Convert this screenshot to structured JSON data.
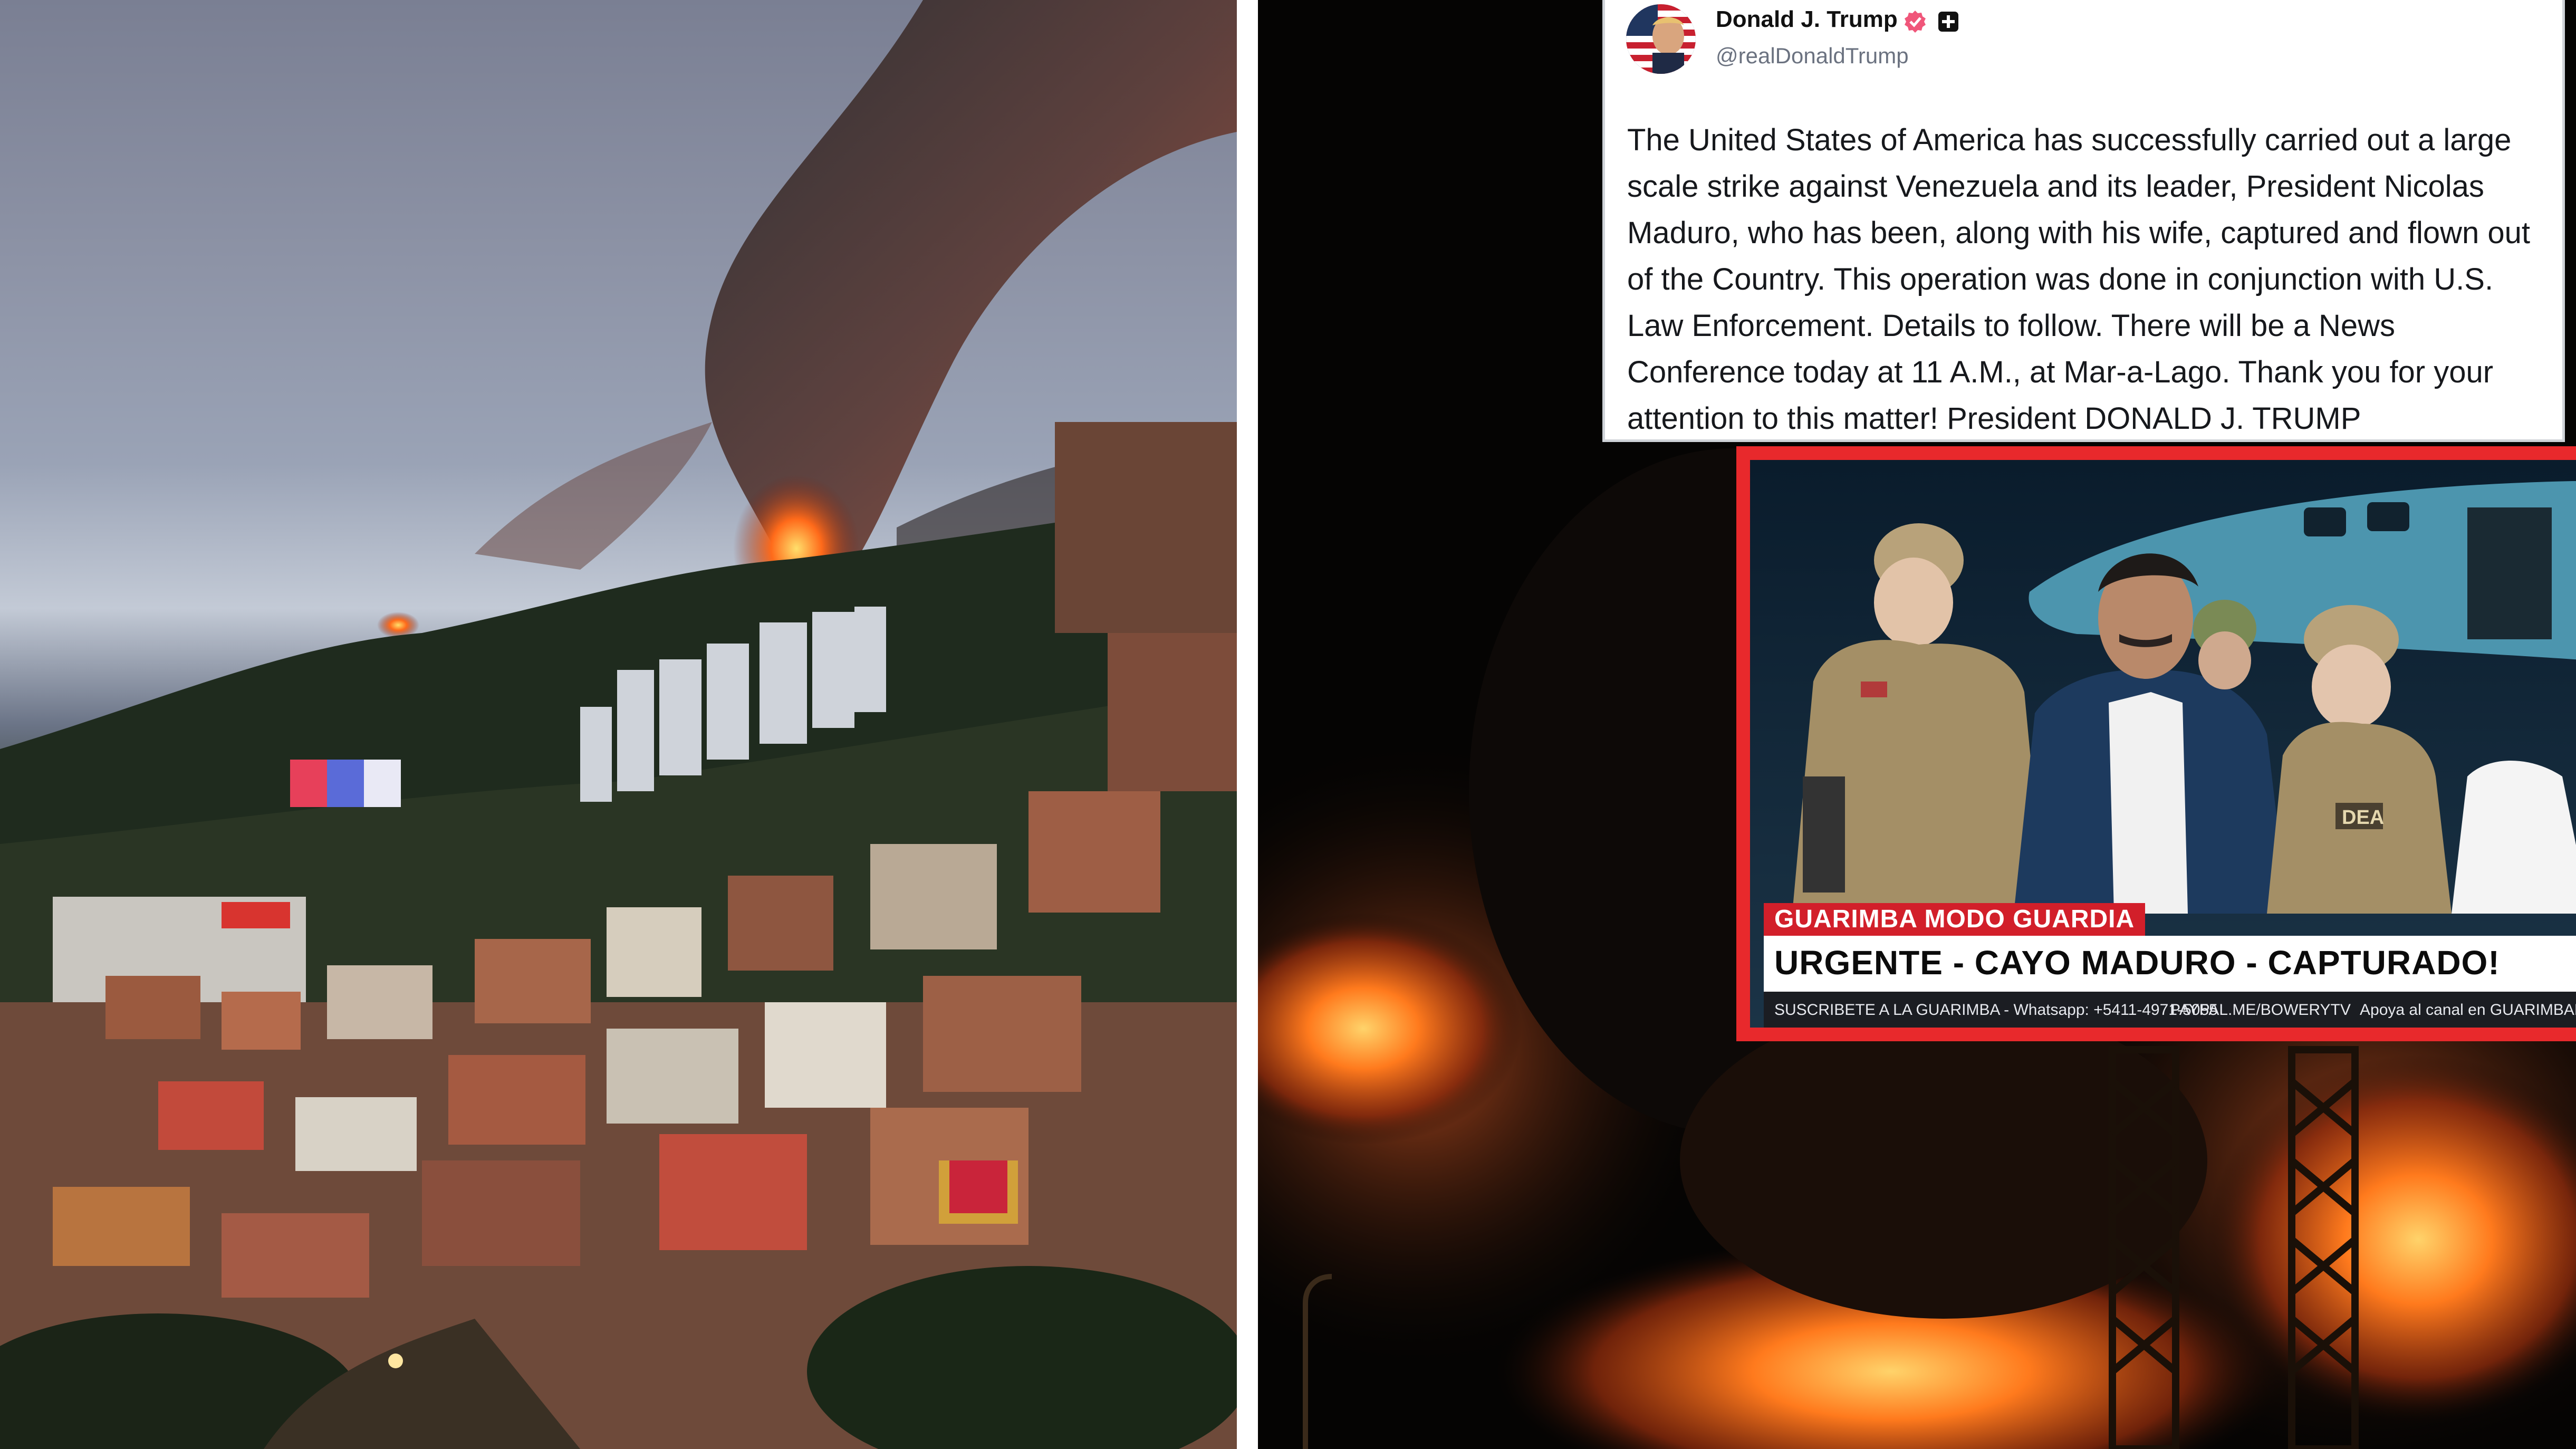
{
  "tweet": {
    "author_name": "Donald J. Trump",
    "author_handle": "@realDonaldTrump",
    "text": "The United States of America has successfully carried out a large scale strike against Venezuela and its leader, President Nicolas Maduro, who has been, along with his wife, captured and flown out of the Country. This operation was done in conjunction with U.S. Law Enforcement. Details to follow. There will be a News Conference today at 11 A.M., at Mar-a-Lago. Thank you for your attention to this matter! President DONALD J. TRUMP",
    "verified_icon": "verified-badge-icon",
    "plus_icon": "plus-badge-icon"
  },
  "news": {
    "tag": "GUARIMBA MODO GUARDIA",
    "headline": "URGENTE - CAYO MADURO - CAPTURADO!",
    "ticker": [
      "SUSCRIBETE A LA GUARIMBA - Whatsapp: +5411-4971-5055",
      "PAYPAL.ME/BOWERYTV",
      "Apoya al canal en GUARIMBADIG"
    ],
    "uniform_patch": "DEA"
  },
  "colors": {
    "inset_border": "#e8292c",
    "news_tag_bg": "#d21f2a",
    "verified": "#f0567a"
  }
}
